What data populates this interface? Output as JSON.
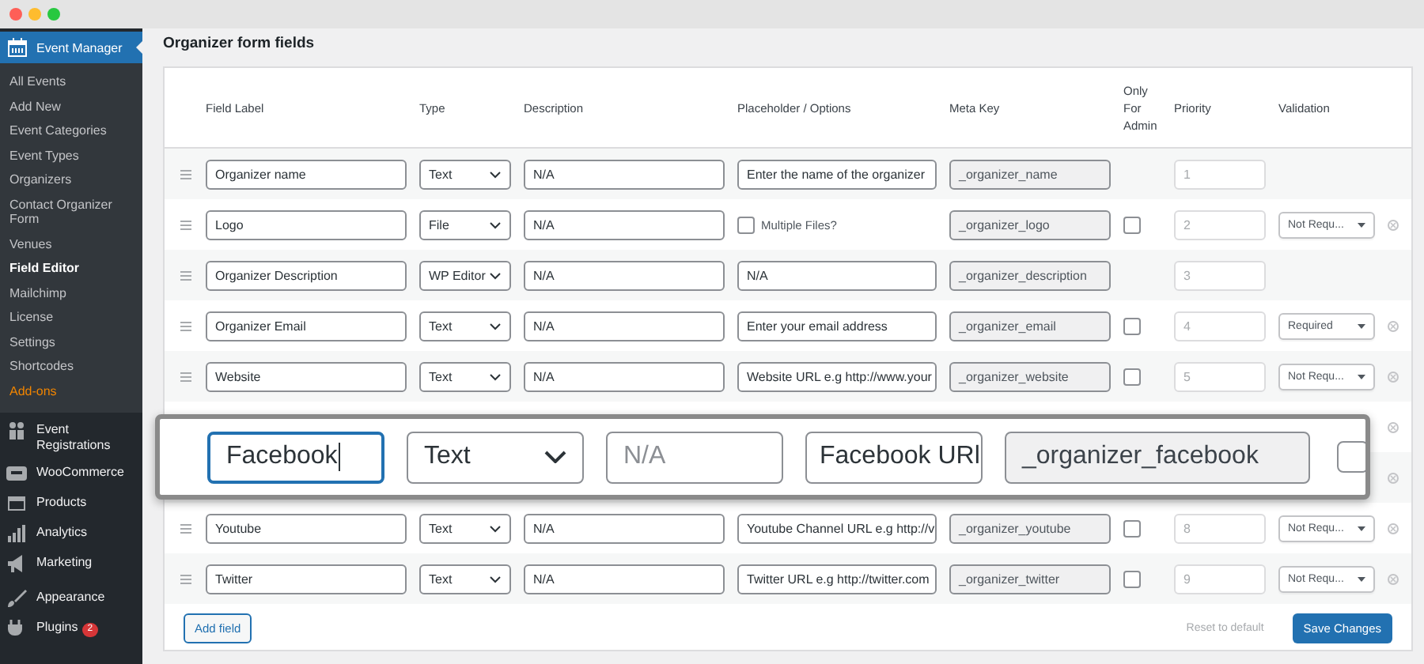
{
  "sidebar": {
    "menu": {
      "label": "Event Manager",
      "selected": true,
      "submenu": [
        {
          "label": "All Events",
          "selected": false,
          "kind": "link"
        },
        {
          "label": "Add New",
          "selected": false,
          "kind": "link"
        },
        {
          "label": "Event Categories",
          "selected": false,
          "kind": "link"
        },
        {
          "label": "Event Types",
          "selected": false,
          "kind": "link"
        },
        {
          "label": "Organizers",
          "selected": false,
          "kind": "link"
        },
        {
          "label": "Contact Organizer Form",
          "selected": false,
          "kind": "link"
        },
        {
          "label": "Venues",
          "selected": false,
          "kind": "link"
        },
        {
          "label": "Field Editor",
          "selected": true,
          "kind": "link"
        },
        {
          "label": "Mailchimp",
          "selected": false,
          "kind": "link"
        },
        {
          "label": "License",
          "selected": false,
          "kind": "link"
        },
        {
          "label": "Settings",
          "selected": false,
          "kind": "link"
        },
        {
          "label": "Shortcodes",
          "selected": false,
          "kind": "link"
        },
        {
          "label": "Add-ons",
          "selected": false,
          "kind": "addon"
        }
      ]
    },
    "items": [
      {
        "label": "Event Registrations"
      },
      {
        "label": "WooCommerce"
      },
      {
        "label": "Products"
      },
      {
        "label": "Analytics"
      },
      {
        "label": "Marketing"
      },
      {
        "label": "Appearance"
      },
      {
        "label": "Plugins",
        "badge": "2"
      }
    ]
  },
  "section_title": "Organizer form fields",
  "table": {
    "columns": [
      "Field Label",
      "Type",
      "Description",
      "Placeholder / Options",
      "Meta Key",
      "Only For Admin",
      "Priority",
      "Validation"
    ],
    "rows": [
      {
        "label": "Organizer name",
        "type": "Text",
        "description": "N/A",
        "kind": "text",
        "placeholder": "Enter the name of the organizer",
        "meta_key": "_organizer_name",
        "priority": "1"
      },
      {
        "label": "Logo",
        "type": "File",
        "description": "N/A",
        "kind": "file",
        "multiple_files": {
          "label": "Multiple Files?",
          "checked": false
        },
        "meta_key": "_organizer_logo",
        "admin_only": {
          "checked": false
        },
        "priority": "2",
        "validation": "Not Requ...",
        "removable": true
      },
      {
        "label": "Organizer Description",
        "type": "WP Editor",
        "description": "N/A",
        "kind": "text",
        "placeholder": "N/A",
        "meta_key": "_organizer_description",
        "priority": "3"
      },
      {
        "label": "Organizer Email",
        "type": "Text",
        "description": "N/A",
        "kind": "text",
        "placeholder": "Enter your email address",
        "meta_key": "_organizer_email",
        "admin_only": {
          "checked": false
        },
        "priority": "4",
        "validation": "Required",
        "removable": true
      },
      {
        "label": "Website",
        "type": "Text",
        "description": "N/A",
        "kind": "text",
        "placeholder": "Website URL e.g http://www.your",
        "meta_key": "_organizer_website",
        "admin_only": {
          "checked": false
        },
        "priority": "5",
        "validation": "Not Requ...",
        "removable": true
      },
      {
        "kind": "covered",
        "removable": true
      },
      {
        "kind": "covered",
        "removable": true
      },
      {
        "label": "Youtube",
        "type": "Text",
        "description": "N/A",
        "kind": "text",
        "placeholder": "Youtube Channel URL e.g http://v",
        "meta_key": "_organizer_youtube",
        "admin_only": {
          "checked": false
        },
        "priority": "8",
        "validation": "Not Requ...",
        "removable": true
      },
      {
        "label": "Twitter",
        "type": "Text",
        "description": "N/A",
        "kind": "text",
        "placeholder": "Twitter URL e.g http://twitter.com",
        "meta_key": "_organizer_twitter",
        "admin_only": {
          "checked": false
        },
        "priority": "9",
        "validation": "Not Requ...",
        "removable": true
      }
    ]
  },
  "footer": {
    "add_button": "Add field",
    "reset_link": "Reset to default",
    "save_button": "Save Changes"
  },
  "zoom_callout": {
    "label": "Facebook",
    "focused": true,
    "type": "Text",
    "description": "N/A",
    "placeholder": "Facebook URl",
    "meta_key": "_organizer_facebook",
    "admin_only": {
      "checked": false
    }
  }
}
